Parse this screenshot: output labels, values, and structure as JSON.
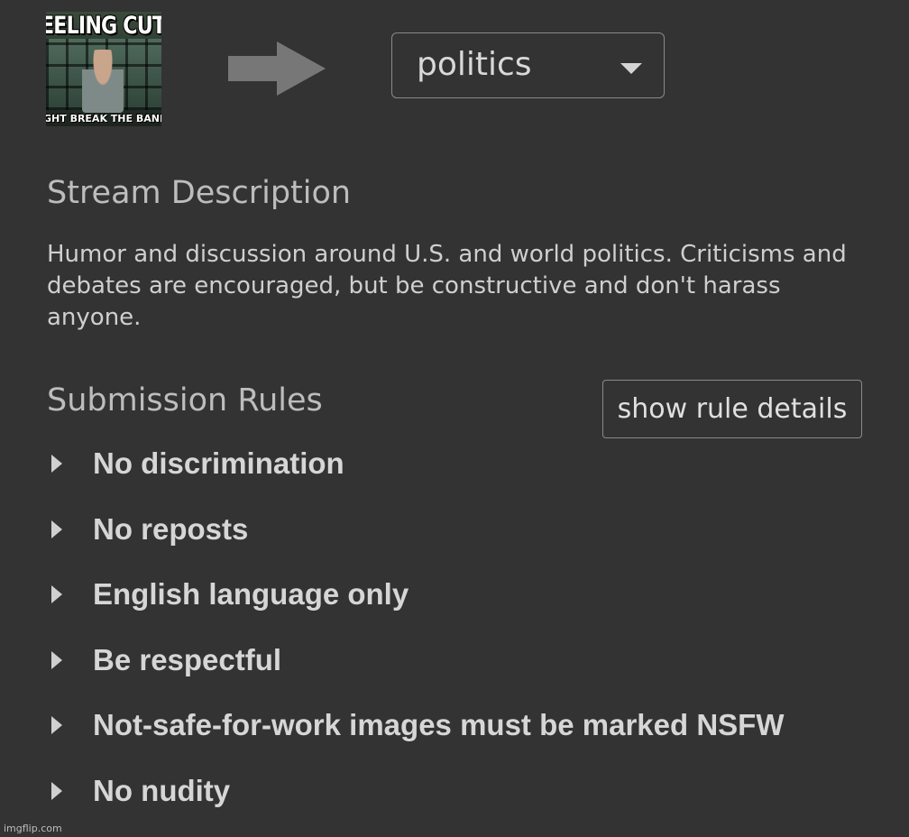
{
  "image": {
    "top_text": "EELING CUT",
    "bottom_text": "GHT BREAK THE BANK LA"
  },
  "arrow_icon": "right-arrow-icon",
  "stream_select": {
    "value": "politics",
    "caret_icon": "caret-down-icon"
  },
  "description": {
    "title": "Stream Description",
    "text": "Humor and discussion around U.S. and world politics. Criticisms and debates are encouraged, but be constructive and don't harass anyone."
  },
  "rules": {
    "title": "Submission Rules",
    "show_details_label": "show rule details",
    "expand_icon": "caret-right-icon",
    "items": [
      {
        "label": "No discrimination"
      },
      {
        "label": "No reposts"
      },
      {
        "label": "English language only"
      },
      {
        "label": "Be respectful"
      },
      {
        "label": "Not-safe-for-work images must be marked NSFW"
      },
      {
        "label": "No nudity"
      }
    ]
  },
  "watermark": "imgflip.com",
  "colors": {
    "background": "#333333",
    "text": "#d4d4d4",
    "border": "#8a8a8a",
    "arrow": "#777777"
  }
}
